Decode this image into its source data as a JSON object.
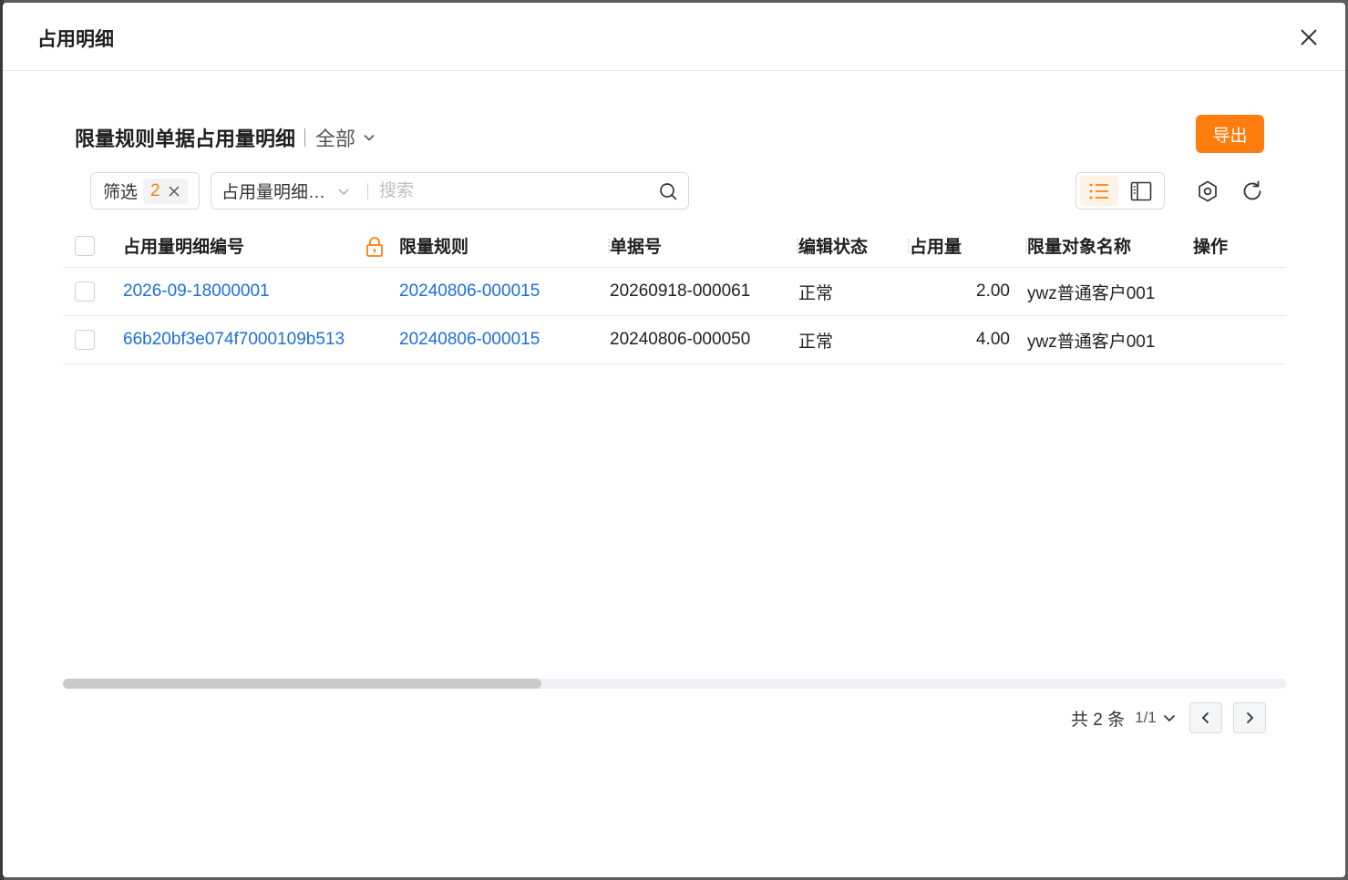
{
  "dialog": {
    "title": "占用明细"
  },
  "section": {
    "title": "限量规则单据占用量明细",
    "scope": "全部",
    "export_label": "导出"
  },
  "filter": {
    "label": "筛选",
    "count": "2"
  },
  "search": {
    "field": "占用量明细…",
    "placeholder": "搜索"
  },
  "table": {
    "headers": {
      "code": "占用量明细编号",
      "rule": "限量规则",
      "bill": "单据号",
      "status": "编辑状态",
      "qty": "占用量",
      "target": "限量对象名称",
      "op": "操作"
    },
    "rows": [
      {
        "code": "2026-09-18000001",
        "rule": "20240806-000015",
        "bill": "20260918-000061",
        "status": "正常",
        "qty": "2.00",
        "target": "ywz普通客户001"
      },
      {
        "code": "66b20bf3e074f7000109b513",
        "rule": "20240806-000015",
        "bill": "20240806-000050",
        "status": "正常",
        "qty": "4.00",
        "target": "ywz普通客户001"
      }
    ]
  },
  "pagination": {
    "total": "共 2 条",
    "page": "1/1"
  },
  "colors": {
    "accent": "#ff7d0f",
    "link": "#1e6fd9"
  }
}
